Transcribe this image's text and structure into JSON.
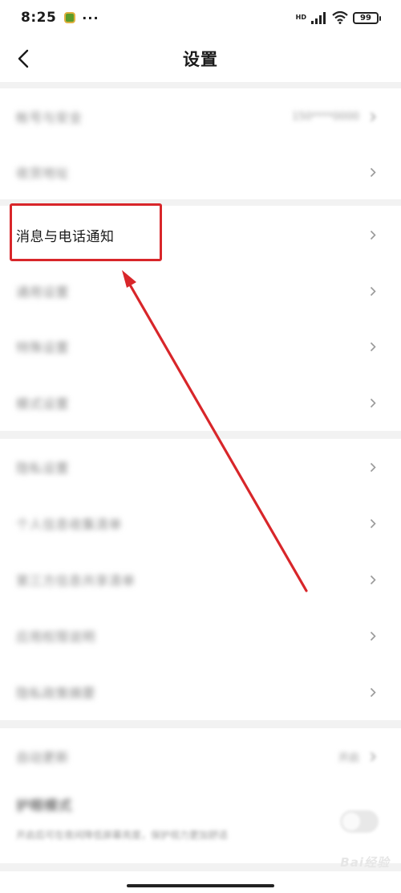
{
  "status_bar": {
    "time": "8:25",
    "more": "···",
    "network": "HD",
    "battery": "99"
  },
  "nav": {
    "title": "设置"
  },
  "section1": [
    {
      "label": "帐号与安全",
      "value": "150****0000"
    },
    {
      "label": "收货地址"
    }
  ],
  "section2": [
    {
      "label": "消息与电话通知"
    },
    {
      "label": "通用设置"
    },
    {
      "label": "特殊设置"
    },
    {
      "label": "模式设置"
    }
  ],
  "section3": [
    {
      "label": "隐私设置"
    },
    {
      "label": "个人信息收集清单"
    },
    {
      "label": "第三方信息共享清单"
    },
    {
      "label": "应用权限说明"
    },
    {
      "label": "隐私政策摘要"
    }
  ],
  "section4": {
    "row1": {
      "label": "自动更新",
      "value": "开启"
    },
    "row2": {
      "label": "护眼模式",
      "sublabel": "开启后可在夜间降低屏幕亮度，保护视力更加舒适"
    }
  },
  "watermark": "Bai经验"
}
